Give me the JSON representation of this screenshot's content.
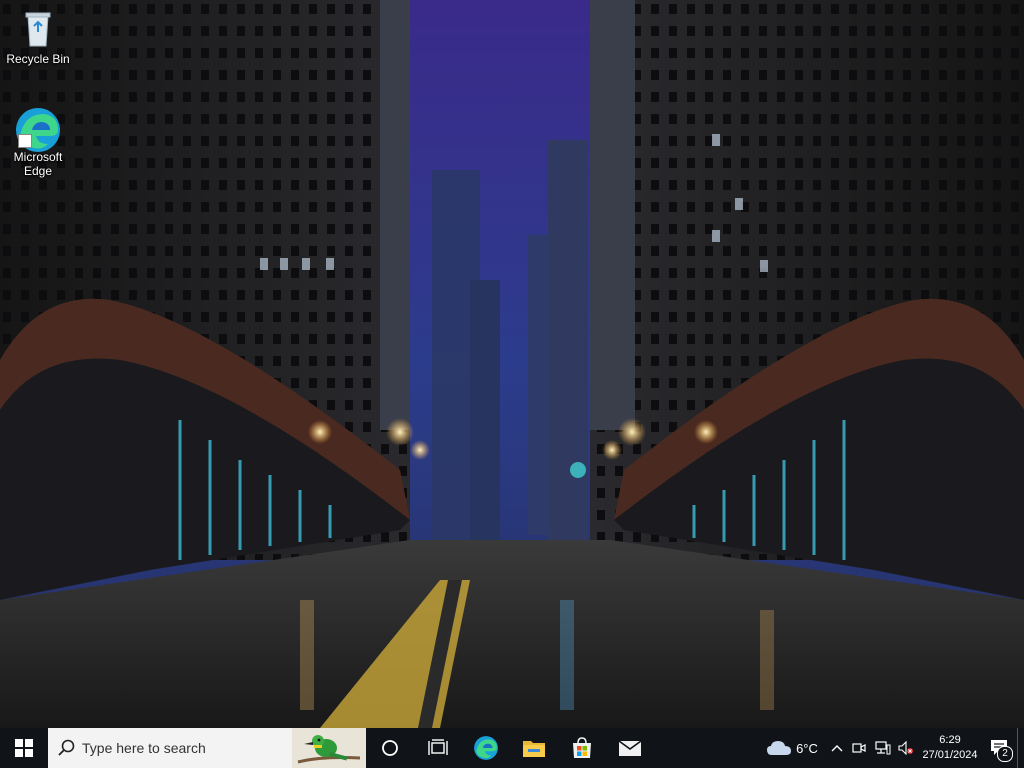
{
  "desktop": {
    "icons": [
      {
        "label": "Recycle Bin",
        "icon": "recycle-bin-icon"
      },
      {
        "label": "Microsoft\nEdge",
        "icon": "edge-icon"
      }
    ],
    "wallpaper": "night-city-bridge"
  },
  "taskbar": {
    "start_icon": "windows-logo-icon",
    "search": {
      "placeholder": "Type here to search"
    },
    "pinned": [
      {
        "name": "cortana",
        "icon": "circle-icon"
      },
      {
        "name": "task-view",
        "icon": "task-view-icon"
      },
      {
        "name": "edge",
        "icon": "edge-icon"
      },
      {
        "name": "file-explorer",
        "icon": "folder-icon"
      },
      {
        "name": "microsoft-store",
        "icon": "store-icon"
      },
      {
        "name": "mail",
        "icon": "mail-icon"
      }
    ]
  },
  "tray": {
    "weather": {
      "temp": "6°C",
      "icon": "cloud-icon"
    },
    "time": "6:29",
    "date": "27/01/2024",
    "notifications": "2"
  },
  "colors": {
    "taskbar": "#101418",
    "search_bg": "#f3f3f3"
  }
}
